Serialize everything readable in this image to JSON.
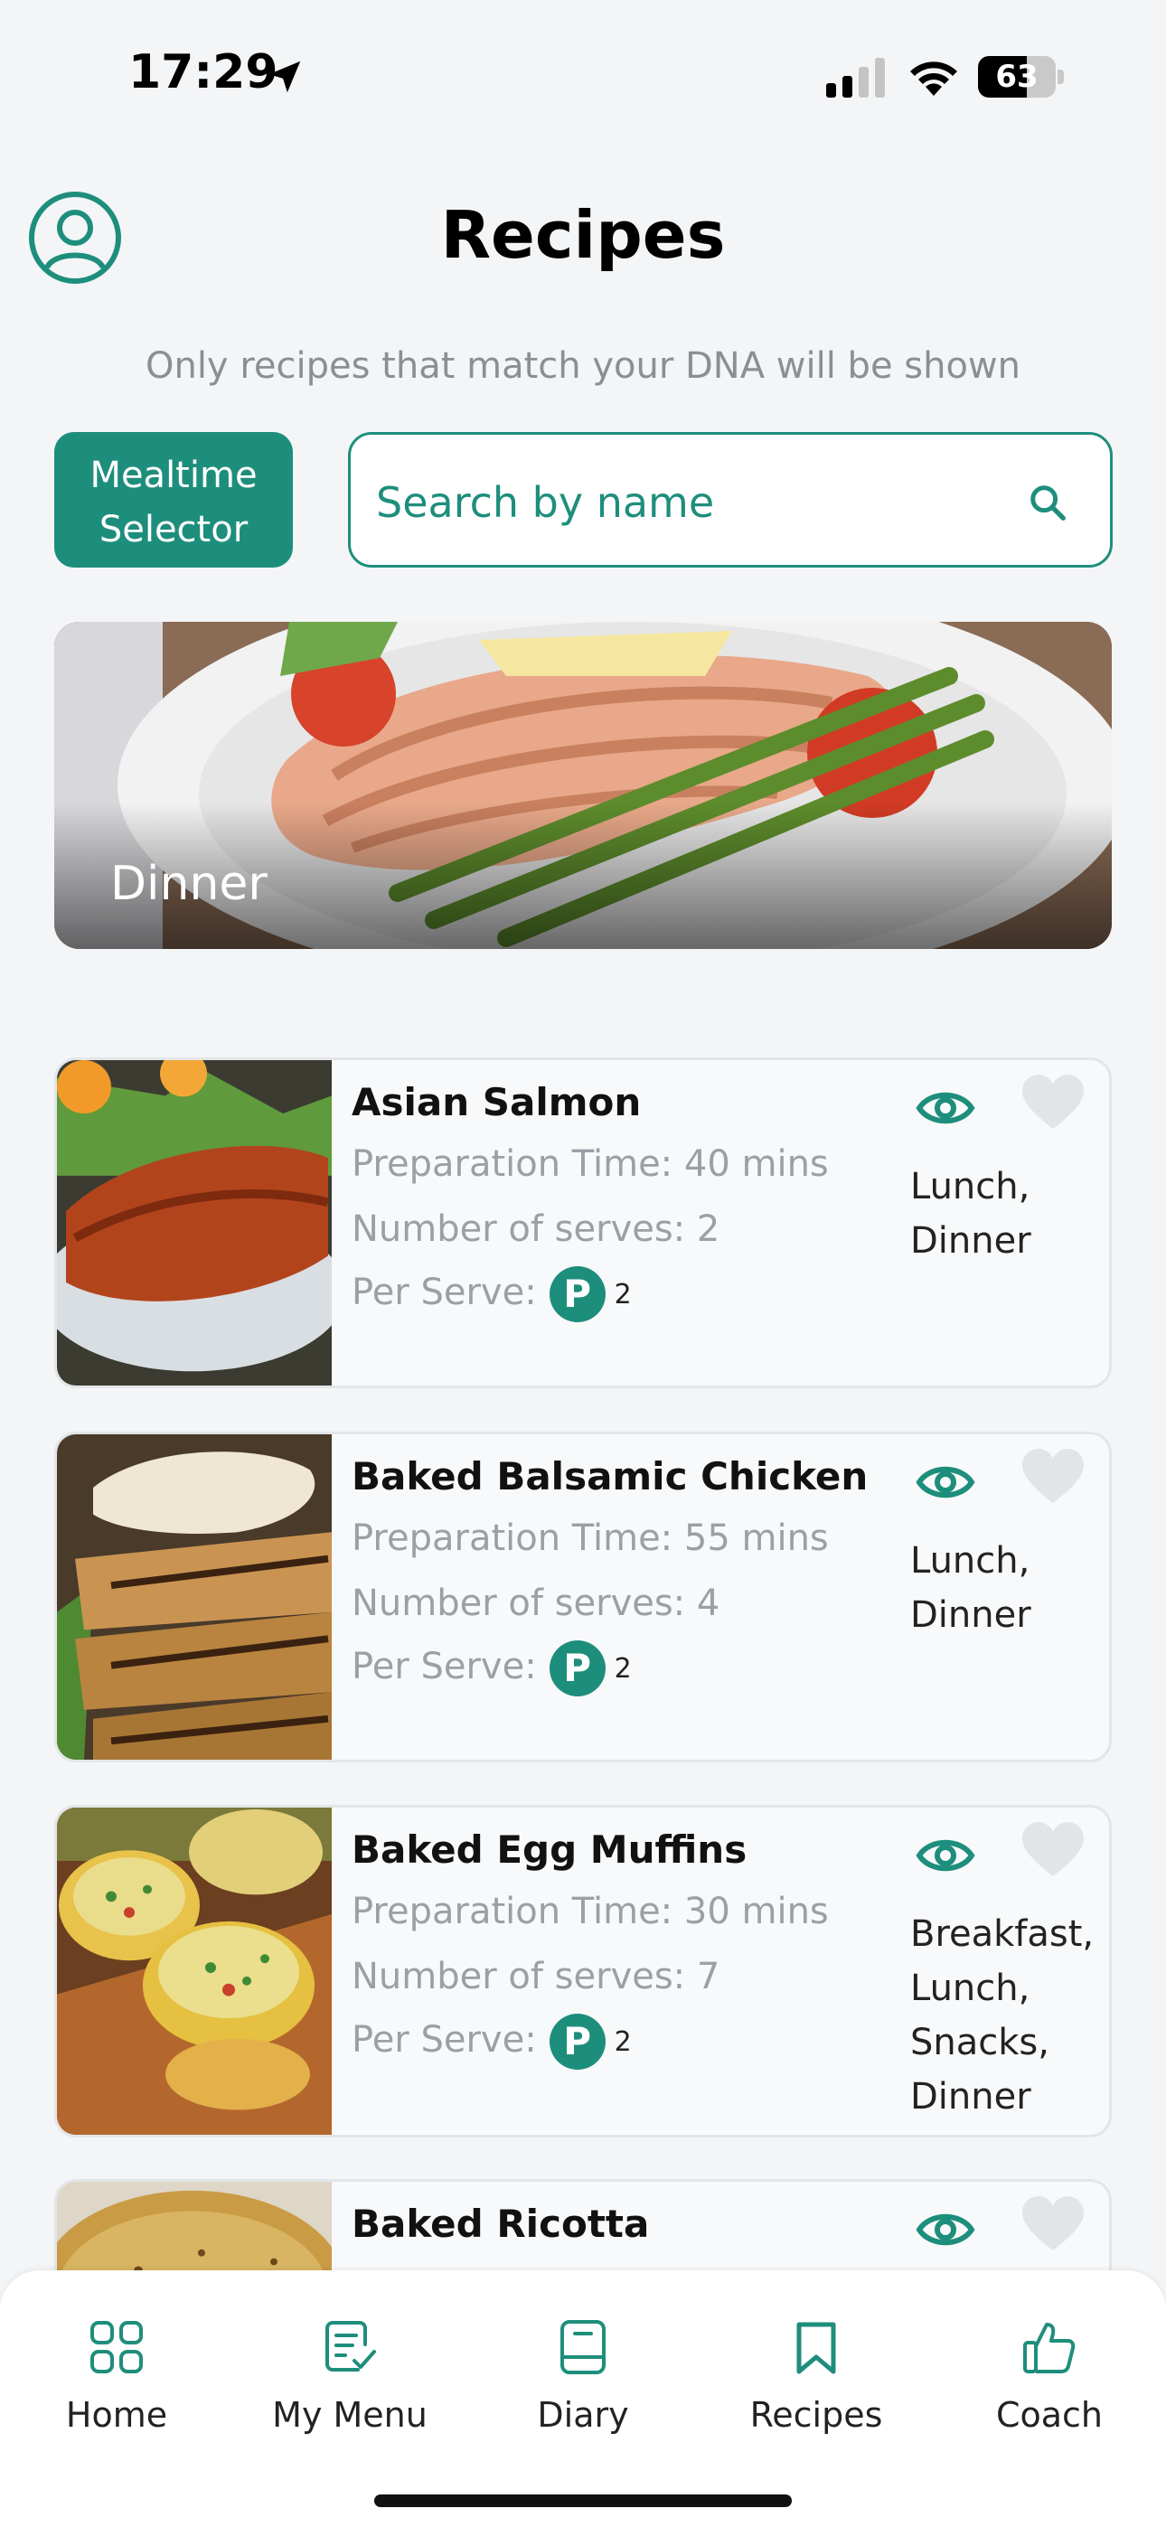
{
  "status_bar": {
    "time": "17:29",
    "battery": "63",
    "battery_level_percent": 63
  },
  "header": {
    "title": "Recipes",
    "profile_icon": "user-circle-icon"
  },
  "note": "Only recipes that match your DNA will be shown",
  "mealtime_selector": {
    "line1": "Mealtime",
    "line2": "Selector"
  },
  "search": {
    "placeholder": "Search by name",
    "icon": "search-icon"
  },
  "hero": {
    "label": "Dinner"
  },
  "recipes": [
    {
      "name": "Asian Salmon",
      "prep": "Preparation Time: 40 mins",
      "serves": "Number of serves: 2",
      "per_serve_label": "Per Serve:",
      "badge": "P",
      "badge_count": "2",
      "meal_types": [
        "Lunch,",
        "Dinner"
      ]
    },
    {
      "name": "Baked Balsamic Chicken",
      "prep": "Preparation Time: 55 mins",
      "serves": "Number of serves: 4",
      "per_serve_label": "Per Serve:",
      "badge": "P",
      "badge_count": "2",
      "meal_types": [
        "Lunch,",
        "Dinner"
      ]
    },
    {
      "name": "Baked Egg Muffins",
      "prep": "Preparation Time: 30 mins",
      "serves": "Number of serves: 7",
      "per_serve_label": "Per Serve:",
      "badge": "P",
      "badge_count": "2",
      "meal_types": [
        "Breakfast,",
        "Lunch,",
        "Snacks,",
        "Dinner"
      ]
    },
    {
      "name": "Baked Ricotta"
    }
  ],
  "nav": {
    "items": [
      {
        "label": "Home",
        "icon": "grid-icon"
      },
      {
        "label": "My Menu",
        "icon": "menu-edit-icon"
      },
      {
        "label": "Diary",
        "icon": "diary-icon"
      },
      {
        "label": "Recipes",
        "icon": "bookmark-icon"
      },
      {
        "label": "Coach",
        "icon": "thumbs-up-icon"
      }
    ],
    "active": "Recipes"
  },
  "colors": {
    "accent": "#1e8e7c",
    "background": "#f3f5f7",
    "muted_text": "#9aa0a5"
  }
}
